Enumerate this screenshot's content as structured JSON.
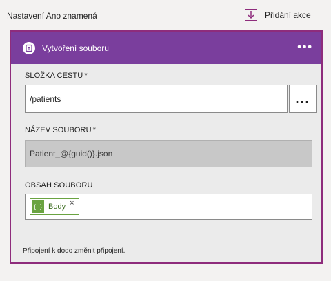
{
  "header": {
    "settings_label": "Nastavení Ano znamená",
    "add_action_label": "Přidání akce"
  },
  "card": {
    "title": "Vytvoření souboru",
    "more_label": "•••",
    "accent_color": "#7a3e9d",
    "border_color": "#8e2c7c"
  },
  "fields": {
    "folder_path": {
      "label": "SLOŽKA CESTU",
      "required_mark": "*",
      "value": "/patients",
      "browse_label": "..."
    },
    "file_name": {
      "label": "NÁZEV SOUBORU",
      "required_mark": "*",
      "value": "Patient_@{guid()}.json"
    },
    "file_content": {
      "label": "OBSAH SOUBORU",
      "token_label": "Body",
      "token_icon_text": "{··}",
      "token_close": "×",
      "token_color": "#6aa341"
    }
  },
  "footer": {
    "connection_text": "Připojení k dodo změnit připojení."
  }
}
